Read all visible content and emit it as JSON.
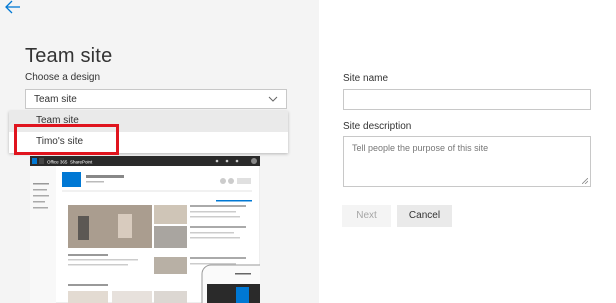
{
  "header": {
    "back_icon": "back-arrow-icon"
  },
  "left": {
    "title": "Team site",
    "choose_label": "Choose a design",
    "dropdown": {
      "selected": "Team site",
      "icon": "chevron-down-icon"
    },
    "options": [
      {
        "label": "Team site",
        "hovered": true
      },
      {
        "label": "Timo's site",
        "hovered": false
      }
    ],
    "highlight_color": "#e0141e",
    "preview": {
      "suite_bar": {
        "app1": "Office 365",
        "app2": "SharePoint"
      },
      "suite_bar_color": "#2a2a2a",
      "accent_color": "#0078d4"
    }
  },
  "form": {
    "site_name_label": "Site name",
    "site_name_value": "",
    "site_description_label": "Site description",
    "site_description_placeholder": "Tell people the purpose of this site",
    "next_label": "Next",
    "cancel_label": "Cancel"
  }
}
